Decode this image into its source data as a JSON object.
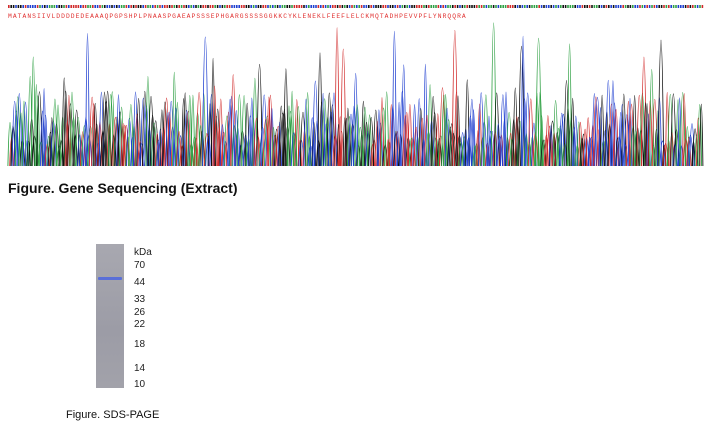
{
  "sequencing": {
    "title": "Figure. Gene Sequencing (Extract)",
    "protein_sequence": "MATANSIIVLDDDDEDEAAAQPGPSHPLPNAASPGAEAPSSSEPHGARGSSSSGGKKCYKLENEKLFEEFLELCKMQTADHPEVVPFLYNRQQRA",
    "colors": {
      "A": "#2ea043",
      "C": "#1f3fd0",
      "G": "#111111",
      "T": "#d12a2a",
      "text": "#e03030"
    }
  },
  "sds_page": {
    "caption": "Figure. SDS-PAGE",
    "unit_label": "kDa",
    "markers": [
      "70",
      "44",
      "33",
      "26",
      "22",
      "18",
      "14",
      "10"
    ],
    "band_color": "#5a6fd8"
  }
}
